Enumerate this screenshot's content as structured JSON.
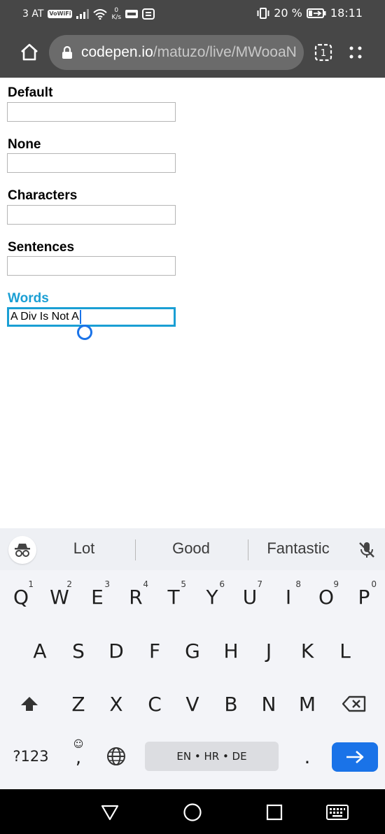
{
  "status_bar": {
    "carrier": "3 AT",
    "vowifi_badge": "VoWiFi",
    "speed_value": "0",
    "speed_unit": "K/s",
    "battery": "20 %",
    "time": "18:11"
  },
  "browser": {
    "url_host": "codepen.io",
    "url_path": "/matuzo/live/MWooaN",
    "tab_count": "1"
  },
  "form": {
    "fields": [
      {
        "label": "Default",
        "value": ""
      },
      {
        "label": "None",
        "value": ""
      },
      {
        "label": "Characters",
        "value": ""
      },
      {
        "label": "Sentences",
        "value": ""
      },
      {
        "label": "Words",
        "value": "A Div Is Not A"
      }
    ]
  },
  "keyboard": {
    "suggestions": [
      "Lot",
      "Good",
      "Fantastic"
    ],
    "row1": [
      {
        "key": "Q",
        "num": "1"
      },
      {
        "key": "W",
        "num": "2"
      },
      {
        "key": "E",
        "num": "3"
      },
      {
        "key": "R",
        "num": "4"
      },
      {
        "key": "T",
        "num": "5"
      },
      {
        "key": "Y",
        "num": "6"
      },
      {
        "key": "U",
        "num": "7"
      },
      {
        "key": "I",
        "num": "8"
      },
      {
        "key": "O",
        "num": "9"
      },
      {
        "key": "P",
        "num": "0"
      }
    ],
    "row2": [
      "A",
      "S",
      "D",
      "F",
      "G",
      "H",
      "J",
      "K",
      "L"
    ],
    "row3": [
      "Z",
      "X",
      "C",
      "V",
      "B",
      "N",
      "M"
    ],
    "symbols_key": "?123",
    "comma_key": ",",
    "space_label": "EN • HR • DE",
    "period_key": "."
  },
  "colors": {
    "accent": "#1a9fd4",
    "enter_key": "#1a73e8",
    "chrome_bar": "#474747"
  }
}
